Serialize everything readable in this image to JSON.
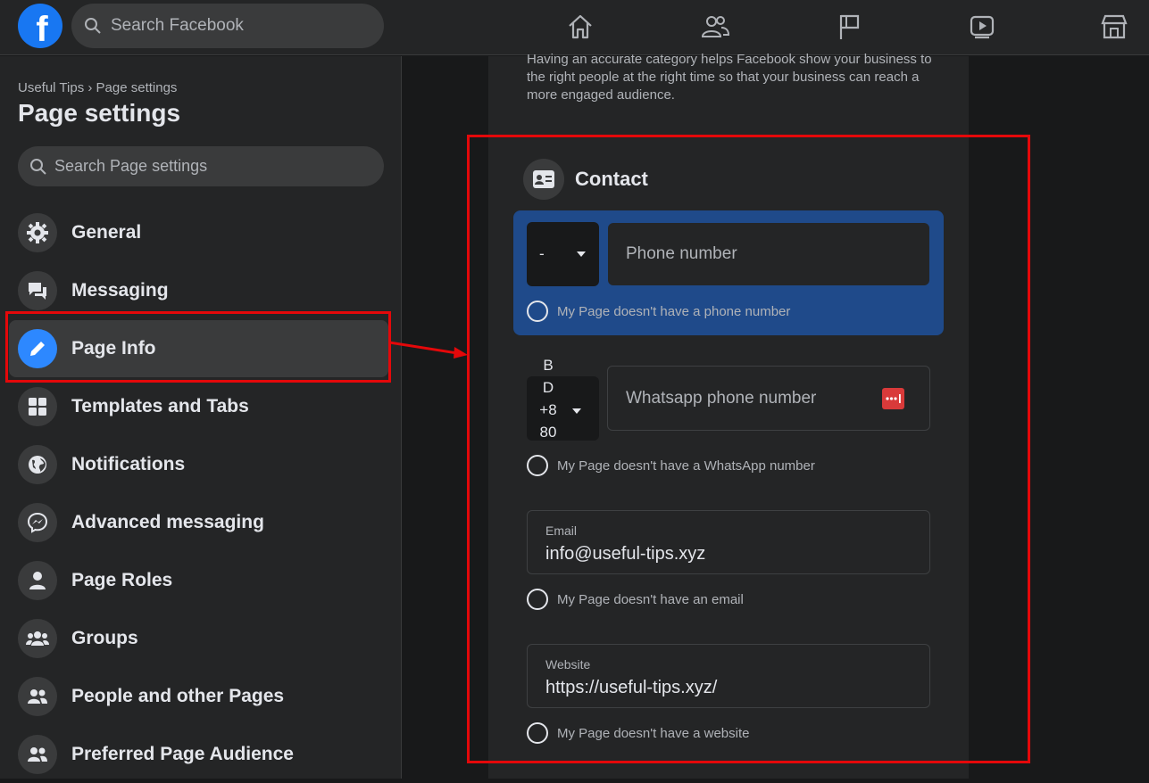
{
  "topbar": {
    "logo": "f",
    "search_placeholder": "Search Facebook",
    "nav_icons": [
      "home-icon",
      "friends-icon",
      "pages-flag-icon",
      "watch-icon",
      "marketplace-icon"
    ]
  },
  "sidebar": {
    "breadcrumb": "Useful Tips › Page settings",
    "title": "Page settings",
    "search_placeholder": "Search Page settings",
    "items": [
      {
        "label": "General",
        "icon": "gear-icon"
      },
      {
        "label": "Messaging",
        "icon": "chat-icon"
      },
      {
        "label": "Page Info",
        "icon": "pencil-icon",
        "active": true
      },
      {
        "label": "Templates and Tabs",
        "icon": "grid-icon"
      },
      {
        "label": "Notifications",
        "icon": "globe-icon"
      },
      {
        "label": "Advanced messaging",
        "icon": "messenger-icon"
      },
      {
        "label": "Page Roles",
        "icon": "person-icon"
      },
      {
        "label": "Groups",
        "icon": "group-icon"
      },
      {
        "label": "People and other Pages",
        "icon": "people-icon"
      },
      {
        "label": "Preferred Page Audience",
        "icon": "people-icon"
      }
    ]
  },
  "main": {
    "intro_text": "Having an accurate category helps Facebook show your business to the right people at the right time so that your business can reach a more engaged audience.",
    "contact": {
      "title": "Contact",
      "phone": {
        "code": "-",
        "placeholder": "Phone number",
        "no_option": "My Page doesn't have a phone number"
      },
      "whatsapp": {
        "code": "BD +880",
        "placeholder": "Whatsapp phone number",
        "no_option": "My Page doesn't have a WhatsApp number"
      },
      "email": {
        "label": "Email",
        "value": "info@useful-tips.xyz",
        "no_option": "My Page doesn't have an email"
      },
      "website": {
        "label": "Website",
        "value": "https://useful-tips.xyz/",
        "no_option": "My Page doesn't have a website"
      }
    }
  },
  "colors": {
    "accent": "#2d88ff",
    "annotation": "#e4080a",
    "phone_highlight": "#1f4a8a"
  }
}
